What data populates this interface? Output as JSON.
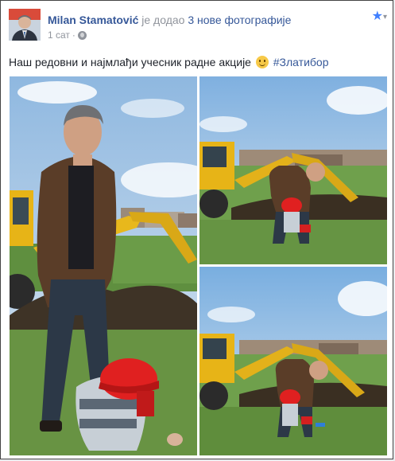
{
  "post": {
    "author": "Milan Stamatović",
    "action": "је додао",
    "photos_link": "3 нове фотографије",
    "time": "1 сат",
    "time_separator": "·",
    "text": "Наш редовни и најмлађи учесник радне акције",
    "hashtag": "#Златибор"
  },
  "icons": {
    "avatar": "avatar",
    "privacy": "globe-icon",
    "star": "star-icon",
    "emoji": "smiley-emoji-icon",
    "menu": "chevron-down-icon"
  },
  "colors": {
    "link": "#365899",
    "meta": "#90949c",
    "text": "#1d2129",
    "star": "#4080ff"
  },
  "photos": [
    {
      "name": "photo-man-and-child-large"
    },
    {
      "name": "photo-man-digging-top"
    },
    {
      "name": "photo-man-digging-bottom"
    }
  ]
}
